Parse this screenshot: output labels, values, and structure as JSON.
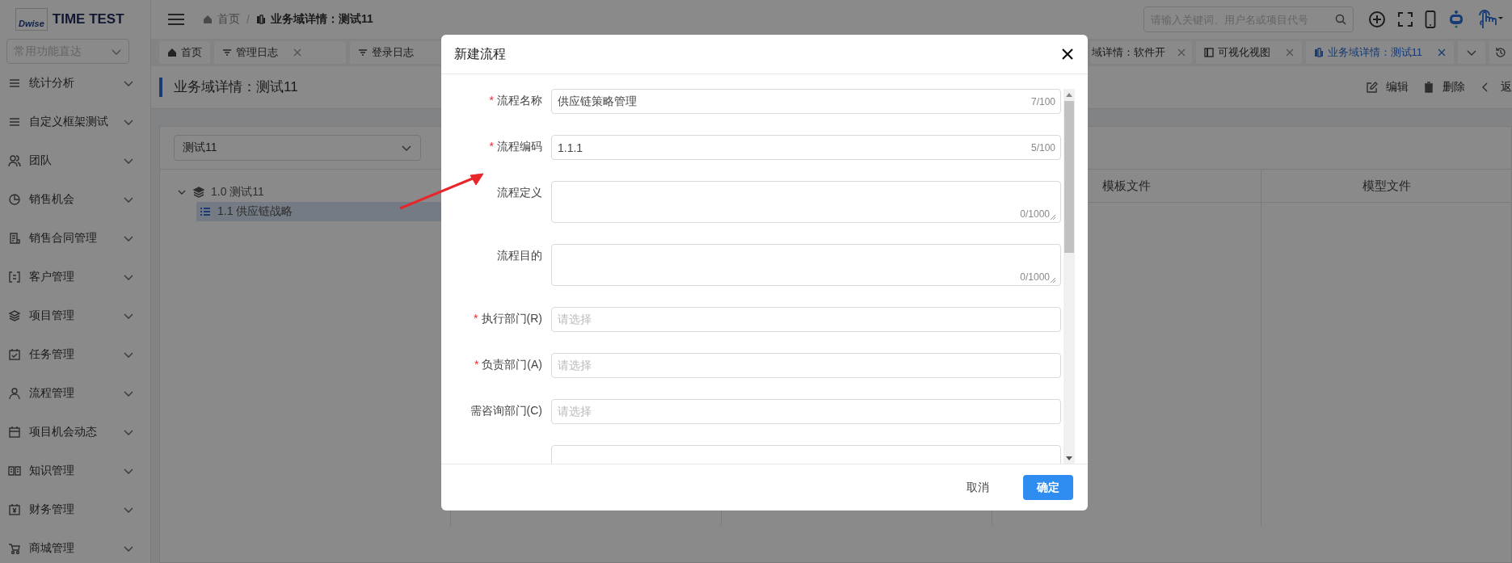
{
  "header": {
    "logo_mark": "Dwise",
    "app_title": "TIME TEST",
    "breadcrumb_separator": "/",
    "breadcrumbs": [
      {
        "label": "首页",
        "current": false
      },
      {
        "label": "业务域详情：测试11",
        "current": true
      }
    ],
    "search": {
      "placeholder": "请输入关键词、用户名或项目代号"
    }
  },
  "sidebar": {
    "quick_access": {
      "placeholder": "常用功能直达"
    },
    "items": [
      {
        "label": "统计分析",
        "expanded": false
      },
      {
        "label": "自定义框架测试",
        "expanded": false
      },
      {
        "label": "团队",
        "expanded": false
      },
      {
        "label": "销售机会",
        "expanded": false
      },
      {
        "label": "销售合同管理",
        "expanded": false
      },
      {
        "label": "客户管理",
        "expanded": false
      },
      {
        "label": "项目管理",
        "expanded": false
      },
      {
        "label": "任务管理",
        "expanded": false
      },
      {
        "label": "流程管理",
        "expanded": false
      },
      {
        "label": "项目机会动态",
        "expanded": false
      },
      {
        "label": "知识管理",
        "expanded": false
      },
      {
        "label": "财务管理",
        "expanded": false
      },
      {
        "label": "商城管理",
        "expanded": false
      }
    ]
  },
  "tabs": [
    {
      "label": "首页",
      "selected": false,
      "closable": false
    },
    {
      "label": "管理日志",
      "selected": false,
      "closable": true
    },
    {
      "label": "登录日志",
      "selected": false,
      "closable": false
    },
    {
      "label": "域详情：软件开",
      "selected": false,
      "closable": true
    },
    {
      "label": "可视化视图",
      "selected": false,
      "closable": true
    },
    {
      "label": "业务域详情：测试11",
      "selected": true,
      "closable": true
    }
  ],
  "page_header": {
    "title": "业务域详情：测试11",
    "actions": [
      {
        "label": "编辑"
      },
      {
        "label": "删除"
      },
      {
        "label": "返"
      }
    ]
  },
  "domain_select": {
    "value": "测试11"
  },
  "tree": [
    {
      "label": "1.0 测试11",
      "expanded": true,
      "selected": false,
      "children": [
        {
          "label": "1.1 供应链战略",
          "selected": true
        }
      ]
    }
  ],
  "table": {
    "columns": [
      {
        "label": "模板文件"
      },
      {
        "label": "模型文件"
      }
    ]
  },
  "dialog": {
    "title": "新建流程",
    "required_mark": "*",
    "fields": [
      {
        "label": "流程名称",
        "required": true,
        "kind": "input",
        "value": "供应链策略管理",
        "counter": "7/100"
      },
      {
        "label": "流程编码",
        "required": true,
        "kind": "input",
        "value": "1.1.1",
        "counter": "5/100"
      },
      {
        "label": "流程定义",
        "required": false,
        "kind": "textarea",
        "counter": "0/1000"
      },
      {
        "label": "流程目的",
        "required": false,
        "kind": "textarea",
        "counter": "0/1000"
      },
      {
        "label": "执行部门(R)",
        "required": true,
        "kind": "select",
        "placeholder": "请选择"
      },
      {
        "label": "负责部门(A)",
        "required": true,
        "kind": "select",
        "placeholder": "请选择"
      },
      {
        "label": "需咨询部门(C)",
        "required": false,
        "kind": "select",
        "placeholder": "请选择"
      },
      {
        "required": false,
        "kind": "input"
      }
    ],
    "buttons": [
      {
        "label": "取消",
        "kind": "text"
      },
      {
        "label": "确定",
        "kind": "primary"
      }
    ]
  }
}
